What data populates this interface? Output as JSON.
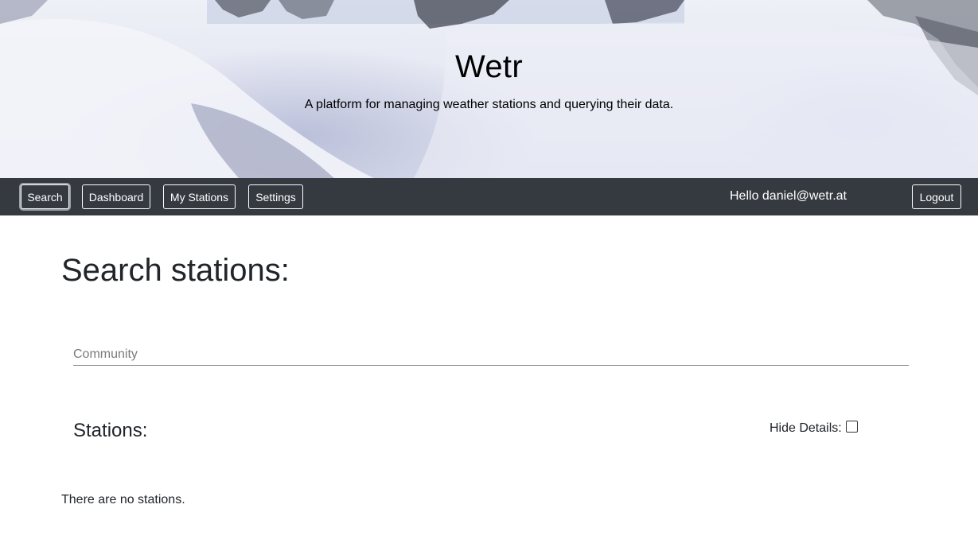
{
  "hero": {
    "title": "Wetr",
    "subtitle": "A platform for managing weather stations and querying their data."
  },
  "nav": {
    "buttons": [
      {
        "label": "Search",
        "active": true
      },
      {
        "label": "Dashboard",
        "active": false
      },
      {
        "label": "My Stations",
        "active": false
      },
      {
        "label": "Settings",
        "active": false
      }
    ],
    "greeting": "Hello daniel@wetr.at",
    "logout_label": "Logout"
  },
  "main": {
    "title": "Search stations:",
    "search_placeholder": "Community",
    "search_value": "",
    "stations_heading": "Stations:",
    "hide_details_label": "Hide Details:",
    "hide_details_checked": false,
    "empty_message": "There are no stations."
  },
  "colors": {
    "navbar_bg": "#343a40",
    "text": "#212529"
  }
}
